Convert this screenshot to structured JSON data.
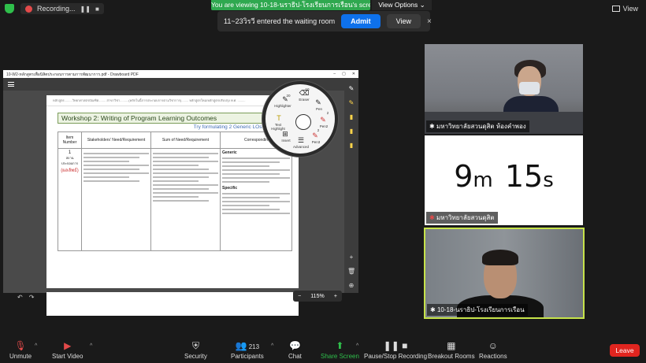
{
  "top": {
    "recording_label": "Recording...",
    "viewing_banner": "You are viewing 10-18-นราธิป-โรงเรียนการเรือน's screen",
    "view_options": "View Options ⌄",
    "view_label": "View"
  },
  "notice": {
    "text": "11~23วิรวี entered the waiting room",
    "admit": "Admit",
    "view": "View",
    "close": "×"
  },
  "shared": {
    "window_title": "10-W2-หลักสูตรเพื่อนิสิตประกอบการตามการพัฒนาการ.pdf - Drawboard PDF",
    "page_header": "หลักสูตร.........วิทยาศาสตรบัณฑิต........ สาขาวิชา..........(หลักในนี้การประกอบการตามวิชาการ)........ หลักสูตรใหม่/หลักสูตรปรับปรุง พ.ศ. .........",
    "workshop_title": "Workshop 2: Writing of Program Learning Outcomes",
    "workshop_sub": "Try formulating 2 Generic LOs + 3 Subject",
    "col_item": "Item Number",
    "col_stakeholder": "Stakeholders' Need/Requirement",
    "col_sum": "Sum of Need/Requirement",
    "col_corr": "Correspondin",
    "item_no": "1",
    "item_note": "สถาน ประกอบการ",
    "item_red": "(ผลลัพธ์)",
    "generic_label": "Generic",
    "specific_label": "Specific",
    "zoom": "115%",
    "zoom_minus": "−",
    "zoom_plus": "+"
  },
  "radial": {
    "items": [
      {
        "label": "Eraser",
        "icon": "⌫"
      },
      {
        "label": "Pen",
        "icon": "✎"
      },
      {
        "label": "Pen2",
        "icon": "✎"
      },
      {
        "label": "Pen3",
        "icon": "✎"
      },
      {
        "label": "Advanced",
        "icon": "☰"
      },
      {
        "label": "Insert",
        "icon": "⊞"
      },
      {
        "label": "Text Highlight",
        "icon": "T"
      },
      {
        "label": "Highlighter",
        "icon": "✎"
      }
    ],
    "size_a": "20",
    "size_b": "10",
    "size_c": "2",
    "size_d": "2"
  },
  "tiles": [
    {
      "label": "มหาวิทยาลัยสวนดุสิต ห้องคำพอง"
    },
    {
      "label": "มหาวิทยาลัยสวนดุสิต",
      "timer_big_1": "9",
      "timer_small_1": "m",
      "timer_big_2": "15",
      "timer_small_2": "s"
    },
    {
      "label": "10-18-นราธิป-โรงเรียนการเรือน"
    }
  ],
  "toolbar": {
    "unmute": "Unmute",
    "start_video": "Start Video",
    "security": "Security",
    "participants": "Participants",
    "participants_count": "213",
    "chat": "Chat",
    "share_screen": "Share Screen",
    "pause_recording": "Pause/Stop Recording",
    "breakout": "Breakout Rooms",
    "reactions": "Reactions",
    "leave": "Leave"
  }
}
